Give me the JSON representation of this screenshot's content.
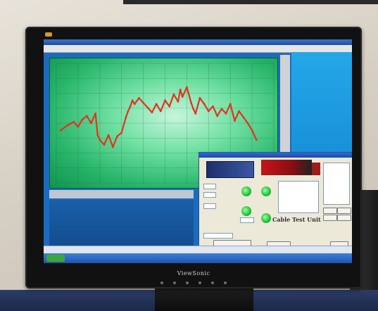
{
  "monitor": {
    "brand": "ViewSonic"
  },
  "dialog": {
    "big_text": "Cable Test Unit"
  },
  "chart_data": {
    "type": "line",
    "title": "",
    "xlabel": "",
    "ylabel": "",
    "xlim": [
      0,
      100
    ],
    "ylim": [
      0,
      100
    ],
    "grid": true,
    "series": [
      {
        "color": "#e1341e",
        "x": [
          2,
          5,
          8,
          10,
          12,
          14,
          16,
          18,
          19,
          20,
          22,
          24,
          26,
          28,
          30,
          32,
          33,
          34,
          35,
          36,
          38,
          40,
          42,
          44,
          46,
          48,
          50,
          52,
          54,
          56,
          57,
          58,
          60,
          62,
          63,
          64,
          66,
          68,
          70,
          72,
          74,
          76,
          78,
          80,
          82,
          84,
          86,
          88,
          90,
          92
        ],
        "y": [
          44,
          48,
          51,
          47,
          53,
          56,
          50,
          58,
          40,
          36,
          32,
          40,
          30,
          39,
          42,
          55,
          60,
          64,
          69,
          66,
          71,
          67,
          63,
          59,
          66,
          60,
          69,
          64,
          74,
          68,
          78,
          72,
          80,
          67,
          62,
          58,
          71,
          66,
          60,
          64,
          56,
          62,
          58,
          66,
          52,
          60,
          55,
          50,
          44,
          36
        ]
      }
    ],
    "colors": {
      "plot_green": "#2ec070",
      "screen_blue": "#1a6cc0"
    }
  }
}
